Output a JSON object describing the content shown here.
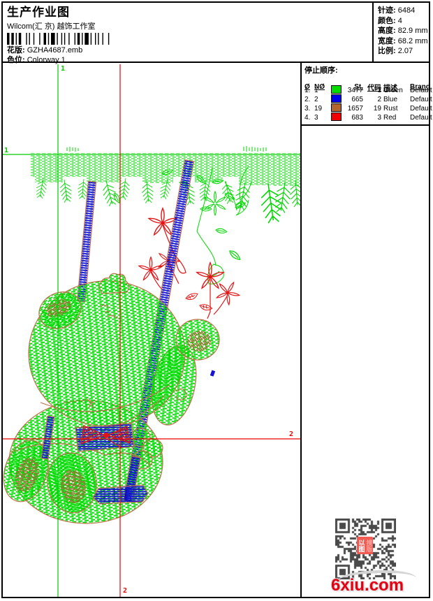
{
  "header": {
    "title": "生产作业图",
    "company": "Wilcom(汇 京) 越饰工作室",
    "design_label": "花版:",
    "design_value": "GZHA4687.emb",
    "colorway_label": "色位:",
    "colorway_value": "Colorway 1"
  },
  "summary": {
    "stitches_label": "针迹:",
    "stitches": "6484",
    "colors_label": "颜色:",
    "colors": "4",
    "height_label": "高度:",
    "height": "82.9 mm",
    "width_label": "宽度:",
    "width": "68.2 mm",
    "scale_label": "比例:",
    "scale": "2.07"
  },
  "stop_sequence": {
    "title": "停止顺序:",
    "headers": {
      "seq": "Ø",
      "needle": "NØ",
      "stitches": "St.",
      "code": "代码",
      "desc": "描述",
      "brand": "Brand",
      "element": "元素"
    },
    "rows": [
      {
        "seq": "1.",
        "needle": "1",
        "color": "#00DC00",
        "stitches": "3477",
        "code": "1",
        "desc": "Green",
        "brand": "Default",
        "element": ""
      },
      {
        "seq": "2.",
        "needle": "2",
        "color": "#0000E8",
        "stitches": "665",
        "code": "2",
        "desc": "Blue",
        "brand": "Default",
        "element": ""
      },
      {
        "seq": "3.",
        "needle": "19",
        "color": "#B4642F",
        "stitches": "1657",
        "code": "19",
        "desc": "Rust",
        "brand": "Default",
        "element": ""
      },
      {
        "seq": "4.",
        "needle": "3",
        "color": "#F00000",
        "stitches": "683",
        "code": "3",
        "desc": "Red",
        "brand": "Default",
        "element": ""
      }
    ]
  },
  "canvas_markers": {
    "start_label": "1",
    "end_label": "2",
    "start_color": "#00CC00",
    "end_color": "#EE0000"
  },
  "watermark": {
    "site": "6xiu.com",
    "stamp_left": "以图",
    "stamp_right": "搜版"
  },
  "palette": {
    "stitch_green": "#00DC00",
    "stitch_blue": "#1414D2",
    "stitch_rust": "#C1714D",
    "stitch_red": "#E41414"
  }
}
